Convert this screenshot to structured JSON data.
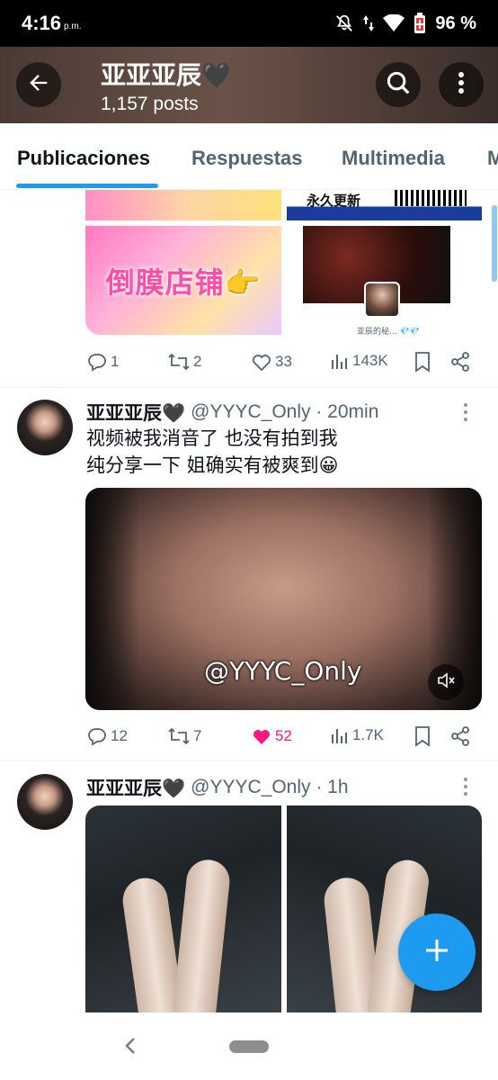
{
  "status_bar": {
    "time": "4:16",
    "ampm": "p.m.",
    "battery": "96 %"
  },
  "header": {
    "name": "亚亚亚辰🖤",
    "posts": "1,157 posts"
  },
  "tabs": [
    {
      "label": "Publicaciones",
      "active": true
    },
    {
      "label": "Respuestas",
      "active": false
    },
    {
      "label": "Multimedia",
      "active": false
    },
    {
      "label": "M",
      "active": false
    }
  ],
  "post1": {
    "media_texts": {
      "banner": "永久更新",
      "shop": "倒膜店铺👉",
      "caption": "亚辰的秘... 💎💎"
    },
    "actions": {
      "replies": "1",
      "retweets": "2",
      "likes": "33",
      "views": "143K"
    }
  },
  "post2": {
    "name": "亚亚亚辰🖤",
    "handle_time": "@YYYC_Only · 20min",
    "text_line1": "视频被我消音了 也没有拍到我",
    "text_line2": "纯分享一下 姐确实有被爽到😀",
    "watermark": "@YYYC_Only",
    "actions": {
      "replies": "12",
      "retweets": "7",
      "likes": "52",
      "views": "1.7K"
    }
  },
  "post3": {
    "name": "亚亚亚辰🖤",
    "handle_time": "@YYYC_Only · 1h"
  },
  "colors": {
    "accent": "#1d9bf0",
    "like": "#f91880",
    "secondary_text": "#536471"
  },
  "icons": [
    "back-arrow-icon",
    "search-icon",
    "more-vertical-icon",
    "reply-icon",
    "retweet-icon",
    "heart-icon",
    "views-icon",
    "bookmark-icon",
    "share-icon",
    "mute-icon",
    "compose-plus-icon"
  ]
}
